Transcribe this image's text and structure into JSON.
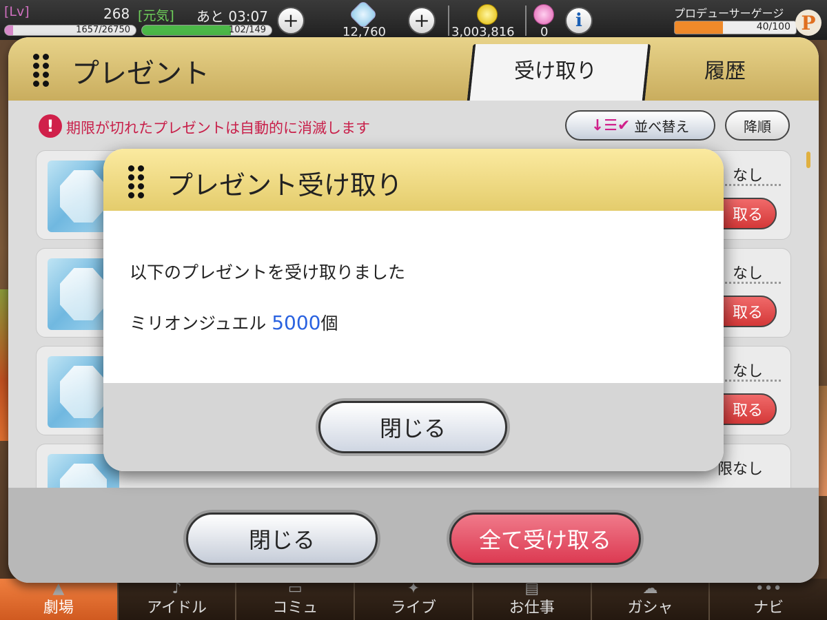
{
  "status_bar": {
    "lv_label": "[Lv]",
    "level": "268",
    "genki_label": "[元気]",
    "time_remaining": "あと 03:07",
    "exp_text": "1657/26750",
    "exp_ratio": 0.062,
    "genki_text": "102/149",
    "genki_ratio": 0.685,
    "jewels": "12,760",
    "money": "3,003,816",
    "hearts": "0",
    "producer_gauge_label": "プロデューサーゲージ",
    "producer_gauge_text": "40/100",
    "producer_gauge_ratio": 0.4,
    "producer_badge": "P",
    "plus_glyph": "+",
    "info_glyph": "i"
  },
  "panel": {
    "title": "プレゼント",
    "tabs": [
      {
        "label": "受け取り",
        "active": true
      },
      {
        "label": "履歴",
        "active": false
      }
    ],
    "notice_glyph": "!",
    "notice": "期限が切れたプレゼントは自動的に消滅します",
    "sort_icon": "↓☰✔",
    "sort_label": "並べ替え",
    "order_label": "降順",
    "items": [
      {
        "limit": "なし",
        "button": "取る"
      },
      {
        "limit": "なし",
        "button": "取る"
      },
      {
        "limit": "なし",
        "button": "取る"
      },
      {
        "limit": "限なし",
        "button": ""
      }
    ],
    "footer_close": "閉じる",
    "footer_receive_all": "全て受け取る"
  },
  "modal": {
    "title": "プレゼント受け取り",
    "message": "以下のプレゼントを受け取りました",
    "item_name": "ミリオンジュエル",
    "item_quantity": "5000",
    "item_unit": "個",
    "close": "閉じる"
  },
  "bottom_nav": [
    {
      "label": "劇場",
      "active": true
    },
    {
      "label": "アイドル",
      "active": false
    },
    {
      "label": "コミュ",
      "active": false
    },
    {
      "label": "ライブ",
      "active": false
    },
    {
      "label": "お仕事",
      "active": false
    },
    {
      "label": "ガシャ",
      "active": false
    },
    {
      "label": "ナビ",
      "active": false
    }
  ],
  "colors": {
    "accent_gold": "#c9ad5e",
    "danger_red": "#d43838",
    "quantity_blue": "#2a62e0",
    "notice_red": "#c8204a"
  }
}
